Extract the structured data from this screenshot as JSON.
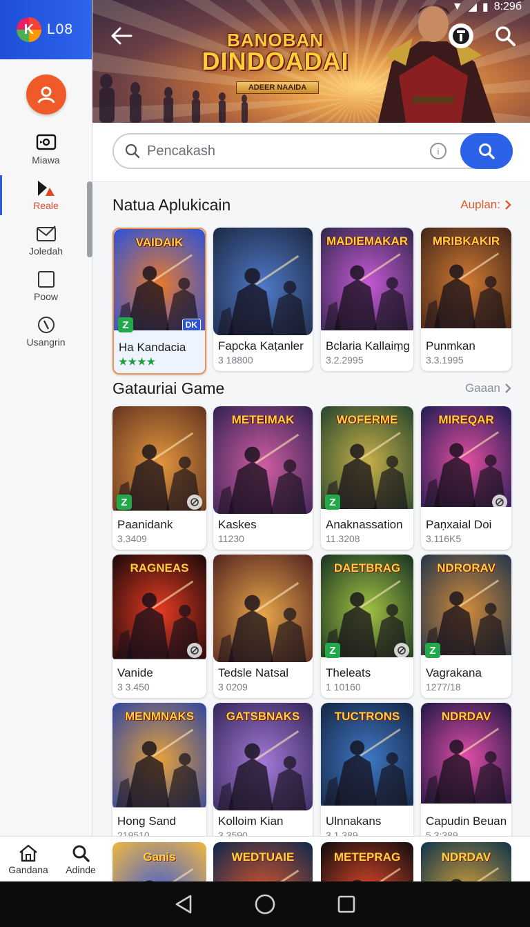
{
  "status_bar": {
    "time": "8:29б"
  },
  "brand": {
    "logo_letter": "K",
    "name": "L08"
  },
  "sidebar": {
    "items": [
      {
        "label": "Miawa",
        "icon": "tv-icon",
        "active": false
      },
      {
        "label": "Reale",
        "icon": "shapes-icon",
        "active": true
      },
      {
        "label": "Joledah",
        "icon": "mail-icon",
        "active": false
      },
      {
        "label": "Poow",
        "icon": "square-icon",
        "active": false
      },
      {
        "label": "Usangrin",
        "icon": "compass-icon",
        "active": false
      }
    ]
  },
  "banner": {
    "title_line1": "BANOBAN",
    "title_line2": "DINDOADAI",
    "subtitle": "ADEER NAAIDA"
  },
  "search": {
    "placeholder": "Pencakash"
  },
  "section1": {
    "title": "Natua Aplukicain",
    "link": "Auplan:",
    "cards": [
      {
        "art_title": "VAIDAIK",
        "name": "Ha Kandacia",
        "meta": "★★★★",
        "palette": [
          "#3554d1",
          "#e87a2c"
        ]
      },
      {
        "art_title": "",
        "name": "Fapcka Kaṭanler",
        "meta": "3 18800",
        "palette": [
          "#1f2d4a",
          "#4f79c8"
        ]
      },
      {
        "art_title": "MADIEMAKAR",
        "name": "Bclaria Kallaiṃg",
        "meta": "3.2.2995",
        "palette": [
          "#3a2a52",
          "#c65ad6"
        ]
      },
      {
        "art_title": "MRIBKAKIR",
        "name": "Punmkan",
        "meta": "3.3.1995",
        "palette": [
          "#4a2a1a",
          "#d07a32"
        ]
      }
    ]
  },
  "section2": {
    "title": "Gatauriai Game",
    "link": "Gaaan",
    "rows": [
      [
        {
          "art_title": "",
          "name": "Paanidank",
          "meta": "3.3409",
          "palette": [
            "#6a3a22",
            "#e3963e"
          ]
        },
        {
          "art_title": "METEIMAK",
          "name": "Kaskes",
          "meta": "11230",
          "palette": [
            "#3b2458",
            "#d15ea2"
          ]
        },
        {
          "art_title": "WOFERME",
          "name": "Anaknassation",
          "meta": "11.3208",
          "palette": [
            "#2f4b2e",
            "#c7b04a"
          ]
        },
        {
          "art_title": "MIREQAR",
          "name": "Paṇxaial Doi",
          "meta": "3.116K5",
          "palette": [
            "#2a1f57",
            "#e24ea0"
          ]
        }
      ],
      [
        {
          "art_title": "RAGNEAS",
          "name": "Vanide",
          "meta": "3 3.450",
          "palette": [
            "#240b0b",
            "#e63b22"
          ]
        },
        {
          "art_title": "",
          "name": "Tedsle Natsal",
          "meta": "3 0209",
          "palette": [
            "#5a2a22",
            "#e8a64a"
          ]
        },
        {
          "art_title": "DAETBRAG",
          "name": "Theleats",
          "meta": "1 10160",
          "palette": [
            "#1f3a22",
            "#a2c244"
          ]
        },
        {
          "art_title": "NDRORAV",
          "name": "Vagrakana",
          "meta": "1277/18",
          "palette": [
            "#2d3a4a",
            "#d08a3a"
          ]
        }
      ],
      [
        {
          "art_title": "MENMNAKS",
          "name": "Hong Sand",
          "meta": "219510",
          "palette": [
            "#3a4a9a",
            "#e6a23c"
          ]
        },
        {
          "art_title": "GATSBNAKS",
          "name": "Kolloim Kian",
          "meta": "3.3590",
          "palette": [
            "#3a2a5e",
            "#a47ad8"
          ]
        },
        {
          "art_title": "TUCTRONS",
          "name": "Ulnnakans",
          "meta": "3.1.389",
          "palette": [
            "#172a4a",
            "#3f78c6"
          ]
        },
        {
          "art_title": "NDRDAV",
          "name": "Capudin Beuan",
          "meta": "5.3:389",
          "palette": [
            "#2a1a4a",
            "#e04ea8"
          ]
        }
      ]
    ]
  },
  "tabbar": {
    "items": [
      {
        "label": "Gandana",
        "icon": "home-icon"
      },
      {
        "label": "Adinde",
        "icon": "search-icon"
      }
    ],
    "peek": [
      {
        "art_title": "Ganis",
        "palette": [
          "#e6b24a",
          "#3a5ad8"
        ]
      },
      {
        "art_title": "WEDTUAIE",
        "palette": [
          "#1a2a4a",
          "#e85a2a"
        ]
      },
      {
        "art_title": "METEPRAG",
        "palette": [
          "#1a1010",
          "#e84a2a"
        ]
      },
      {
        "art_title": "NDRDAV",
        "palette": [
          "#1a3a4a",
          "#d8a23a"
        ]
      }
    ]
  }
}
